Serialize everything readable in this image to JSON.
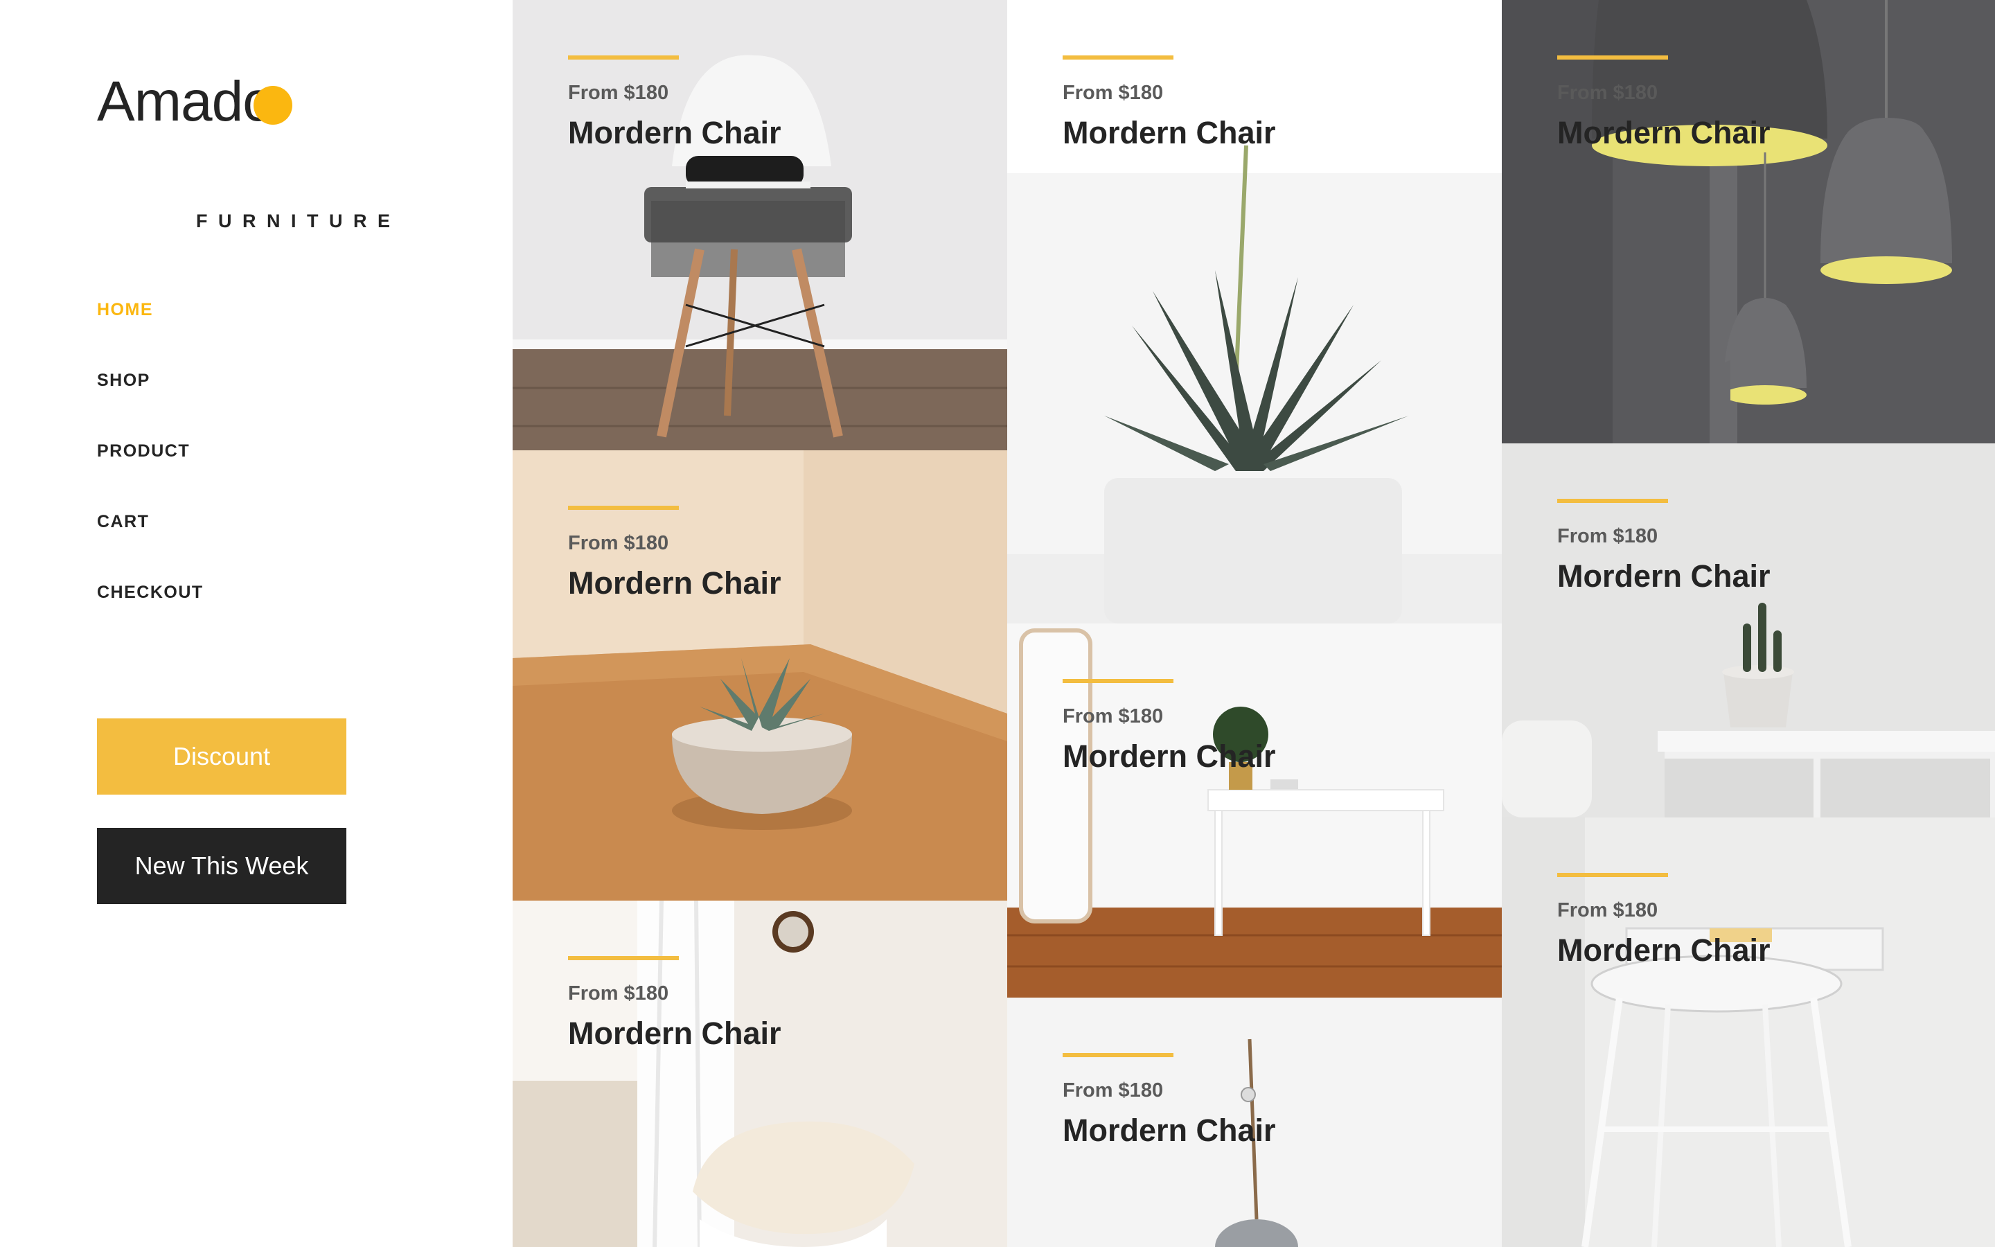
{
  "brand": {
    "name": "Amado",
    "tagline": "FURNITURE",
    "accent": "#fbb710"
  },
  "nav": [
    {
      "label": "HOME",
      "active": true
    },
    {
      "label": "SHOP",
      "active": false
    },
    {
      "label": "PRODUCT",
      "active": false
    },
    {
      "label": "CART",
      "active": false
    },
    {
      "label": "CHECKOUT",
      "active": false
    }
  ],
  "buttons": {
    "discount": "Discount",
    "new_this_week": "New This Week"
  },
  "colors": {
    "accent": "#f3bd40",
    "dark": "#242424",
    "price": "#5a5a5a"
  },
  "products": [
    {
      "price": "From $180",
      "name": "Mordern Chair",
      "image": "white-chair-with-sneakers"
    },
    {
      "price": "From $180",
      "name": "Mordern Chair",
      "image": "succulent-on-wooden-table"
    },
    {
      "price": "From $180",
      "name": "Mordern Chair",
      "image": "fur-covered-chair-by-window"
    },
    {
      "price": "From $180",
      "name": "Mordern Chair",
      "image": "aloe-plant-in-white-pot"
    },
    {
      "price": "From $180",
      "name": "Mordern Chair",
      "image": "white-console-table-with-mirror"
    },
    {
      "price": "From $180",
      "name": "Mordern Chair",
      "image": "hanging-speaker"
    },
    {
      "price": "From $180",
      "name": "Mordern Chair",
      "image": "pendant-lamps"
    },
    {
      "price": "From $180",
      "name": "Mordern Chair",
      "image": "cactus-on-white-cabinet"
    },
    {
      "price": "From $180",
      "name": "Mordern Chair",
      "image": "white-wire-stool"
    }
  ]
}
